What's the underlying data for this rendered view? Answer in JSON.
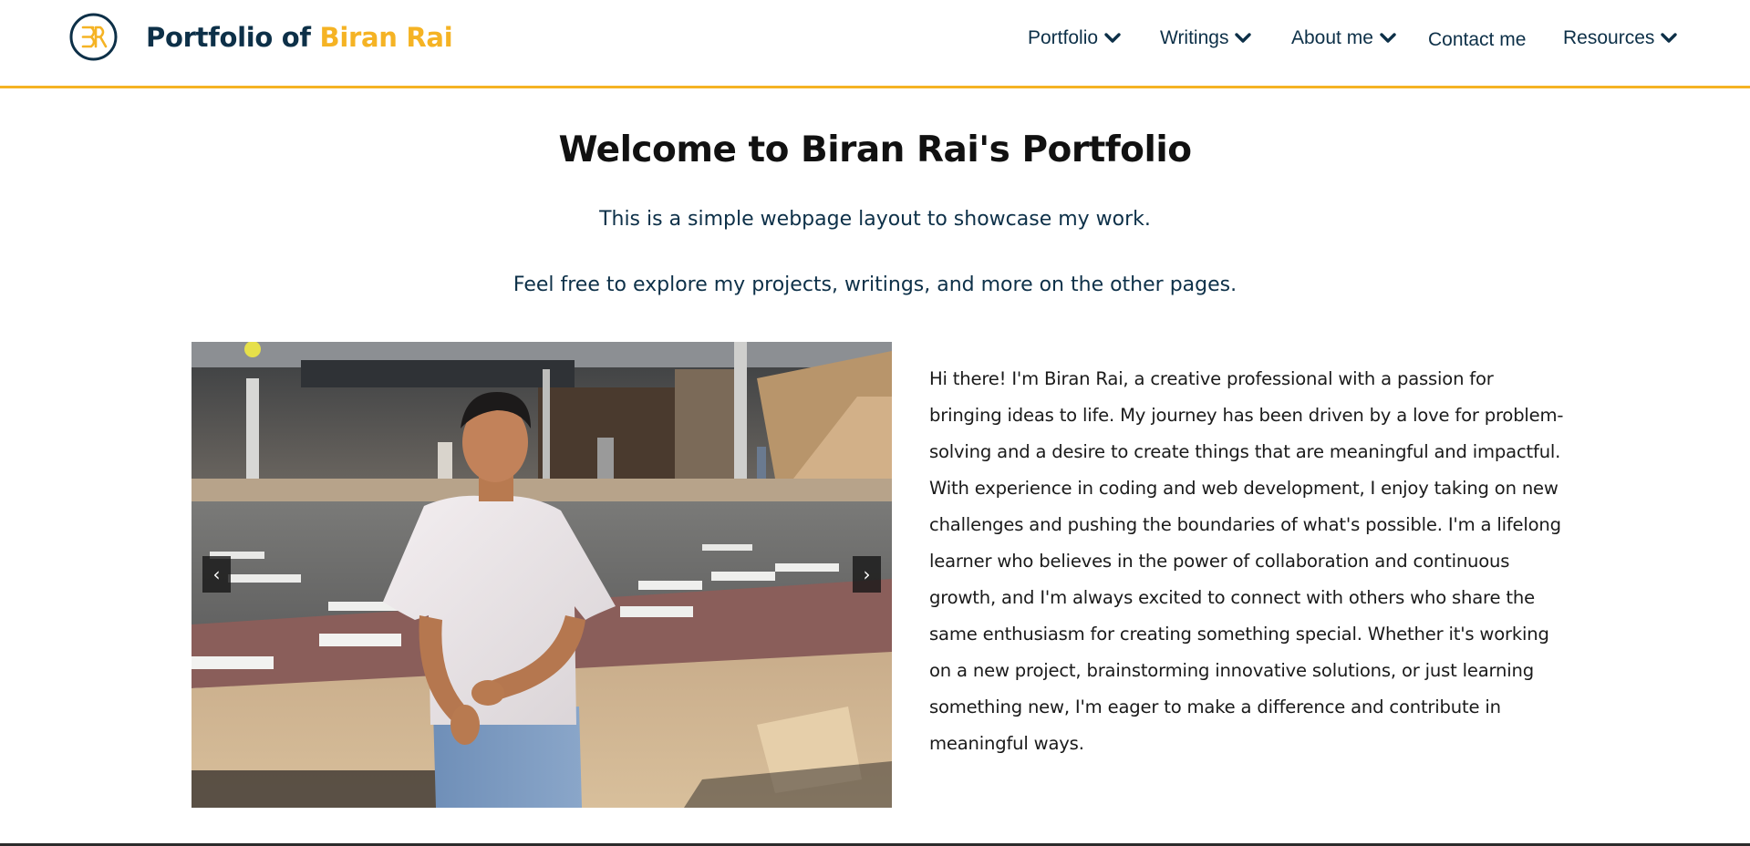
{
  "header": {
    "brand_prefix": "Portfolio of",
    "brand_name": "Biran Rai",
    "logo_letters": "BR",
    "accent_color": "#f5b324",
    "primary_color": "#0d3048"
  },
  "nav": {
    "items": [
      {
        "label": "Portfolio",
        "has_dropdown": true
      },
      {
        "label": "Writings",
        "has_dropdown": true
      },
      {
        "label": "About me",
        "has_dropdown": true
      },
      {
        "label": "Contact me",
        "has_dropdown": false
      },
      {
        "label": "Resources",
        "has_dropdown": true
      }
    ]
  },
  "main": {
    "title": "Welcome to Biran Rai's Portfolio",
    "intro_1": "This is a simple webpage layout to showcase my work.",
    "intro_2": "Feel free to explore my projects, writings, and more on the other pages.",
    "carousel": {
      "prev_label": "‹",
      "next_label": "›"
    },
    "bio": "Hi there! I'm Biran Rai, a creative professional with a passion for bringing ideas to life. My journey has been driven by a love for problem-solving and a desire to create things that are meaningful and impactful. With experience in coding and web development, I enjoy taking on new challenges and pushing the boundaries of what's possible. I'm a lifelong learner who believes in the power of collaboration and continuous growth, and I'm always excited to connect with others who share the same enthusiasm for creating something special. Whether it's working on a new project, brainstorming innovative solutions, or just learning something new, I'm eager to make a difference and contribute in meaningful ways."
  }
}
